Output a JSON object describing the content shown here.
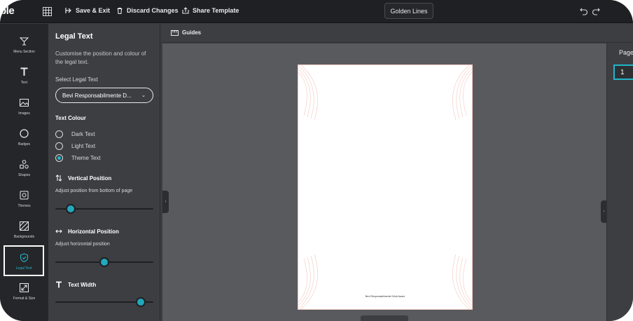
{
  "topbar": {
    "logo": "ble",
    "save_exit": "Save & Exit",
    "discard": "Discard Changes",
    "share": "Share Template",
    "template_name": "Golden Lines"
  },
  "iconbar": {
    "items": [
      {
        "label": "Menu Section",
        "icon": "cocktail-glass-icon"
      },
      {
        "label": "Text",
        "icon": "text-t-icon"
      },
      {
        "label": "Images",
        "icon": "image-icon"
      },
      {
        "label": "Badges",
        "icon": "circle-icon"
      },
      {
        "label": "Shapes",
        "icon": "shapes-icon"
      },
      {
        "label": "Themes",
        "icon": "palette-icon"
      },
      {
        "label": "Backgrounds",
        "icon": "hatched-square-icon"
      },
      {
        "label": "Legal Text",
        "icon": "shield-icon",
        "active": true
      },
      {
        "label": "Format & Size",
        "icon": "resize-icon"
      }
    ]
  },
  "panel": {
    "title": "Legal Text",
    "description": "Customise the position and colour of the legal text.",
    "select_label": "Select Legal Text",
    "select_value": "Bevi Responsabilmente D...",
    "text_colour": {
      "heading": "Text Colour",
      "options": [
        "Dark Text",
        "Light Text",
        "Theme Text"
      ],
      "selected": "Theme Text"
    },
    "vertical": {
      "heading": "Vertical Position",
      "hint": "Adjust position from bottom of page",
      "value_fraction": 0.16
    },
    "horizontal": {
      "heading": "Horizontal Position",
      "hint": "Adjust horizontal position",
      "value_fraction": 0.5
    },
    "width": {
      "heading": "Text Width",
      "value_fraction": 0.87
    }
  },
  "canvas": {
    "guides_label": "Guides",
    "legal_text": "Bevi Responsabilmente Drink Aware"
  },
  "pages": {
    "label": "Pages",
    "current": "1"
  },
  "colors": {
    "accent": "#22b5c9",
    "border_lines": "#f1c9c1"
  }
}
